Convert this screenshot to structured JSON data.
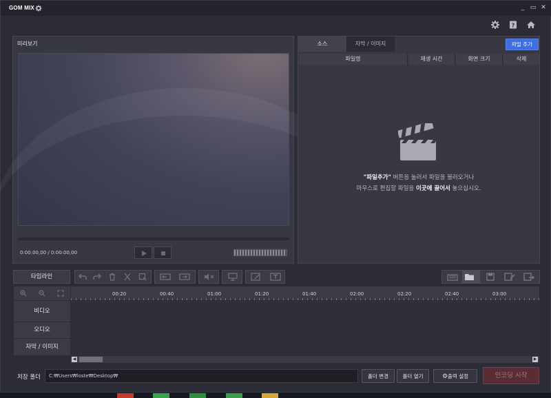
{
  "app": {
    "title": "GOM MIX",
    "accent": "#3e6ee0",
    "encode_color": "#5a2d34"
  },
  "window_controls": {
    "minimize": "_",
    "maximize": "▭",
    "close": "✕"
  },
  "top_icons": [
    "settings-icon",
    "help-icon",
    "home-icon"
  ],
  "preview": {
    "title": "미리보기",
    "time": "0:00:00,00 / 0:00:00,00"
  },
  "source": {
    "tabs": [
      "소스",
      "자막 / 이미지"
    ],
    "add_file": "파일 추가",
    "columns": [
      "파일명",
      "재생 시간",
      "화면 크기",
      "삭제"
    ],
    "empty_line1_bold": "\"파일추가\"",
    "empty_line1_rest": " 버튼을 눌러서 파일을 불러오거나",
    "empty_line2_pre": "마우스로 편집할 파일을 ",
    "empty_line2_bold": "이곳에 끌어서",
    "empty_line2_post": " 놓으십시오."
  },
  "timeline": {
    "label": "타임라인",
    "ticks": [
      "00:20",
      "00:40",
      "01:00",
      "01:20",
      "01:40",
      "02:00",
      "02:20",
      "02:40",
      "03:00"
    ],
    "tracks": [
      "비디오",
      "오디오",
      "자막 / 이미지"
    ]
  },
  "bottom": {
    "save_folder_label": "저장 폴더",
    "path": "C:₩Users₩loste₩Desktop₩",
    "change_folder": "폴더 변경",
    "open_folder": "폴더 열기",
    "output_settings": "출력 설정",
    "start_encoding": "인코딩 시작"
  }
}
